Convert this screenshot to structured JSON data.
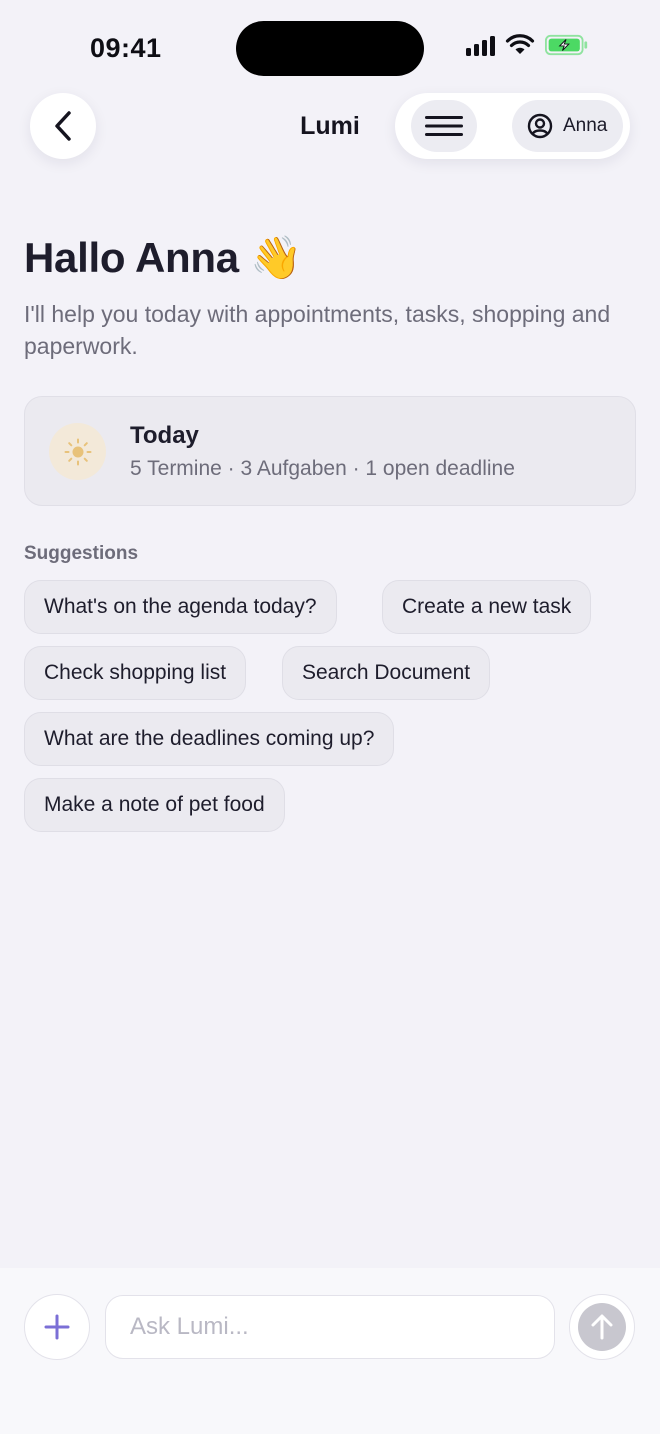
{
  "status_bar": {
    "time": "09:41"
  },
  "nav": {
    "title": "Lumi",
    "account_name": "Anna"
  },
  "greeting": {
    "title": "Hallo Anna 👋",
    "subtitle": "I'll help you today with appointments, tasks, shopping and paperwork."
  },
  "today_card": {
    "title": "Today",
    "meta": "5 Termine · 3 Aufgaben · 1 open deadline"
  },
  "suggestions": {
    "label": "Suggestions",
    "items": [
      "What's on the agenda today?",
      "Create a new task",
      "Check shopping list",
      "Search Document",
      "What are the deadlines coming up?",
      "Make a note of pet food"
    ]
  },
  "composer": {
    "placeholder": "Ask Lumi..."
  },
  "colors": {
    "background": "#f3f2f8",
    "accent": "#7b6fd6",
    "battery": "#4cd964",
    "sun": "#e8c27a"
  },
  "icons": [
    "back-chevron-icon",
    "menu-icon",
    "user-circle-icon",
    "sun-icon",
    "plus-icon",
    "arrow-up-icon",
    "signal-icon",
    "wifi-icon",
    "battery-icon"
  ]
}
